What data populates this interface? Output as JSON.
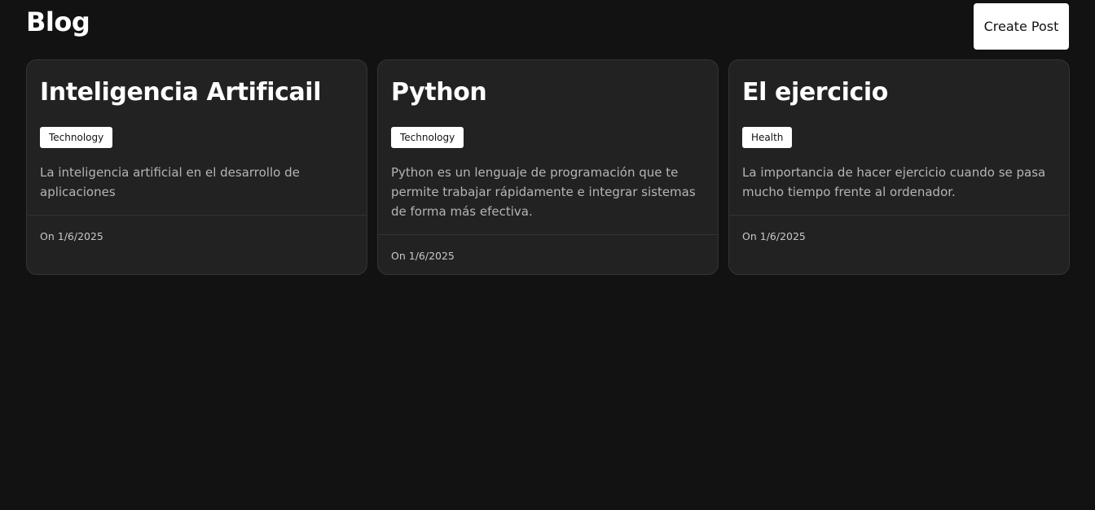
{
  "header": {
    "title": "Blog",
    "create_button_label": "Create Post"
  },
  "posts": [
    {
      "title": "Inteligencia Artificail",
      "tag": "Technology",
      "description": "La inteligencia artificial en el desarrollo de aplicaciones",
      "date": "On 1/6/2025"
    },
    {
      "title": "Python",
      "tag": "Technology",
      "description": "Python es un lenguaje de programación que te permite trabajar rápidamente e integrar sistemas de forma más efectiva.",
      "date": "On 1/6/2025"
    },
    {
      "title": "El ejercicio",
      "tag": "Health",
      "description": "La importancia de hacer ejercicio cuando se pasa mucho tiempo frente al ordenador.",
      "date": "On 1/6/2025"
    }
  ],
  "colors": {
    "background": "#121212",
    "card": "#222222",
    "card_border": "#343434",
    "text_primary": "#ffffff",
    "text_secondary": "#b5b5b5",
    "button_bg": "#ffffff"
  }
}
